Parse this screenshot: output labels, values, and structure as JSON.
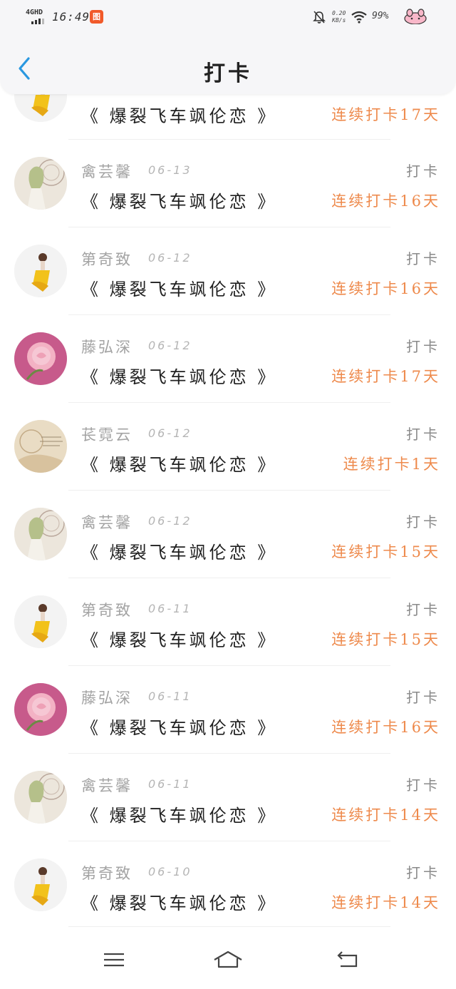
{
  "status_bar": {
    "network": "4GHD",
    "time": "16:49",
    "app_badge": "图",
    "net_speed": "0.20 KB/s",
    "battery": "99%",
    "icons": [
      "signal-icon",
      "mute-bell-icon",
      "wifi-icon",
      "mascot-icon"
    ]
  },
  "header": {
    "title": "打卡",
    "back_icon": "chevron-left-icon"
  },
  "colors": {
    "accent": "#2a98e0",
    "streak": "#ee8a4c",
    "name": "#a3a3a3",
    "title": "#1f1f1f"
  },
  "checkins": [
    {
      "name": "",
      "date": "",
      "type": "",
      "book": "《 爆裂飞车飒伦恋 》",
      "streak": "连续打卡17天",
      "avatar": "yellow-dress-girl"
    },
    {
      "name": "禽芸馨",
      "date": "06-13",
      "type": "打卡",
      "book": "《 爆裂飞车飒伦恋 》",
      "streak": "连续打卡16天",
      "avatar": "sketch-girl"
    },
    {
      "name": "第奇致",
      "date": "06-12",
      "type": "打卡",
      "book": "《 爆裂飞车飒伦恋 》",
      "streak": "连续打卡16天",
      "avatar": "yellow-dress-girl"
    },
    {
      "name": "藤弘深",
      "date": "06-12",
      "type": "打卡",
      "book": "《 爆裂飞车飒伦恋 》",
      "streak": "连续打卡17天",
      "avatar": "pink-rose"
    },
    {
      "name": "苌霓云",
      "date": "06-12",
      "type": "打卡",
      "book": "《 爆裂飞车飒伦恋 》",
      "streak": "连续打卡1天",
      "avatar": "sepia-art"
    },
    {
      "name": "禽芸馨",
      "date": "06-12",
      "type": "打卡",
      "book": "《 爆裂飞车飒伦恋 》",
      "streak": "连续打卡15天",
      "avatar": "sketch-girl"
    },
    {
      "name": "第奇致",
      "date": "06-11",
      "type": "打卡",
      "book": "《 爆裂飞车飒伦恋 》",
      "streak": "连续打卡15天",
      "avatar": "yellow-dress-girl"
    },
    {
      "name": "藤弘深",
      "date": "06-11",
      "type": "打卡",
      "book": "《 爆裂飞车飒伦恋 》",
      "streak": "连续打卡16天",
      "avatar": "pink-rose"
    },
    {
      "name": "禽芸馨",
      "date": "06-11",
      "type": "打卡",
      "book": "《 爆裂飞车飒伦恋 》",
      "streak": "连续打卡14天",
      "avatar": "sketch-girl"
    },
    {
      "name": "第奇致",
      "date": "06-10",
      "type": "打卡",
      "book": "《 爆裂飞车飒伦恋 》",
      "streak": "连续打卡14天",
      "avatar": "yellow-dress-girl"
    }
  ],
  "bottom_nav": [
    "menu-icon",
    "home-icon",
    "back-icon"
  ]
}
